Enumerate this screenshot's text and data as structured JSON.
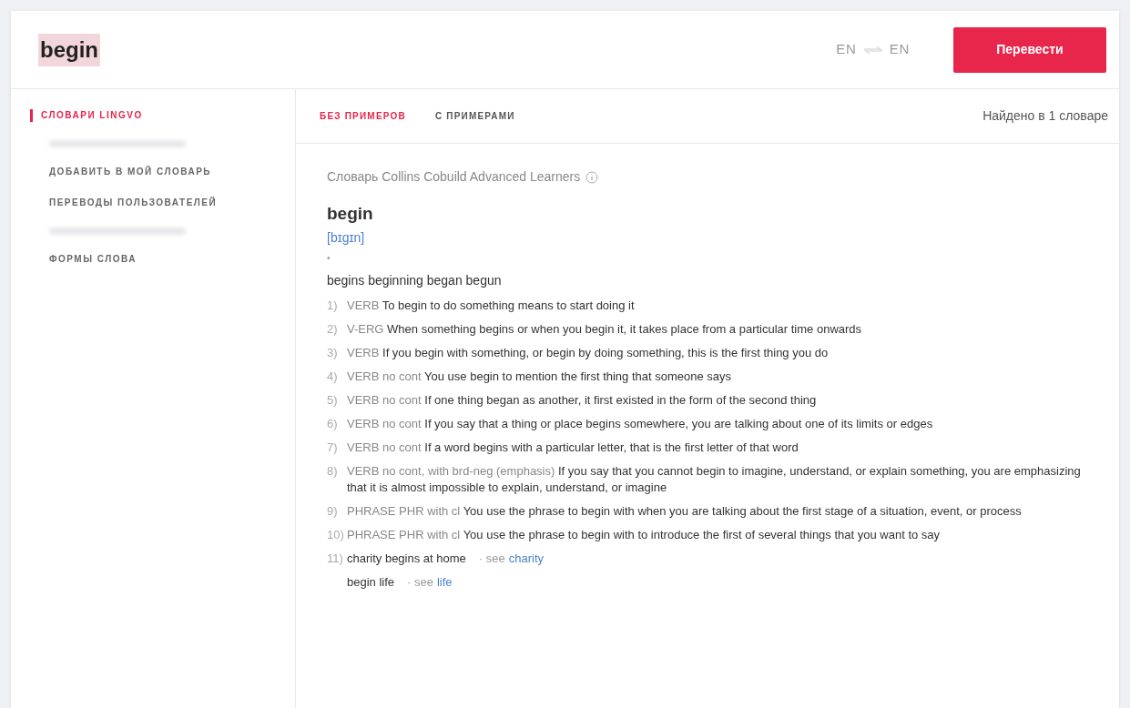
{
  "search": {
    "value": "begin",
    "highlighted": true
  },
  "languages": {
    "source": "EN",
    "target": "EN"
  },
  "translate_button": "Перевести",
  "sidebar": {
    "items": [
      {
        "kind": "link",
        "label": "СЛОВАРИ LINGVO",
        "selected": true
      },
      {
        "kind": "blurred"
      },
      {
        "kind": "link",
        "label": "ДОБАВИТЬ В МОЙ СЛОВАРЬ",
        "selected": false
      },
      {
        "kind": "link",
        "label": "ПЕРЕВОДЫ ПОЛЬЗОВАТЕЛЕЙ",
        "selected": false
      },
      {
        "kind": "blurred"
      },
      {
        "kind": "link",
        "label": "ФОРМЫ СЛОВА",
        "selected": false
      }
    ]
  },
  "tabs": [
    {
      "label": "БЕЗ ПРИМЕРОВ",
      "selected": true
    },
    {
      "label": "С ПРИМЕРАМИ",
      "selected": false
    }
  ],
  "found": "Найдено в 1 словаре",
  "entry": {
    "dictionary": "Словарь Collins Cobuild Advanced Learners",
    "headword": "begin",
    "transcription": "[bɪgɪn]",
    "mark": "•",
    "forms": "begins beginning began begun",
    "senses": [
      {
        "kind": "sense",
        "number": "1)",
        "grammar": "VERB",
        "definition": "To begin to do something means to start doing it"
      },
      {
        "kind": "sense",
        "number": "2)",
        "grammar": "V-ERG",
        "definition": "When something begins or when you begin it, it takes place from a particular time onwards"
      },
      {
        "kind": "sense",
        "number": "3)",
        "grammar": "VERB",
        "definition": "If you begin with something, or begin by doing something, this is the first thing you do"
      },
      {
        "kind": "sense",
        "number": "4)",
        "grammar": "VERB no cont",
        "definition": "You use begin to mention the first thing that someone says"
      },
      {
        "kind": "sense",
        "number": "5)",
        "grammar": "VERB no cont",
        "definition": "If one thing began as another, it first existed in the form of the second thing"
      },
      {
        "kind": "sense",
        "number": "6)",
        "grammar": "VERB no cont",
        "definition": "If you say that a thing or place begins somewhere, you are talking about one of its limits or edges"
      },
      {
        "kind": "sense",
        "number": "7)",
        "grammar": "VERB no cont",
        "definition": "If a word begins with a particular letter, that is the first letter of that word"
      },
      {
        "kind": "sense",
        "number": "8)",
        "grammar": "VERB no cont, with brd-neg (emphasis)",
        "definition": "If you say that you cannot begin to imagine, understand, or explain something, you are emphasizing that it is almost impossible to explain, understand, or imagine"
      },
      {
        "kind": "sense",
        "number": "9)",
        "grammar": "PHRASE PHR with cl",
        "definition": "You use the phrase to begin with when you are talking about the first stage of a situation, event, or process"
      },
      {
        "kind": "sense",
        "number": "10)",
        "grammar": "PHRASE PHR with cl",
        "definition": "You use the phrase to begin with to introduce the first of several things that you want to say"
      },
      {
        "kind": "see",
        "number": "11)",
        "phrase": "charity begins at home",
        "see": "· see",
        "link": "charity"
      },
      {
        "kind": "see",
        "phrase": "begin life",
        "see": "· see",
        "link": "life"
      }
    ]
  }
}
